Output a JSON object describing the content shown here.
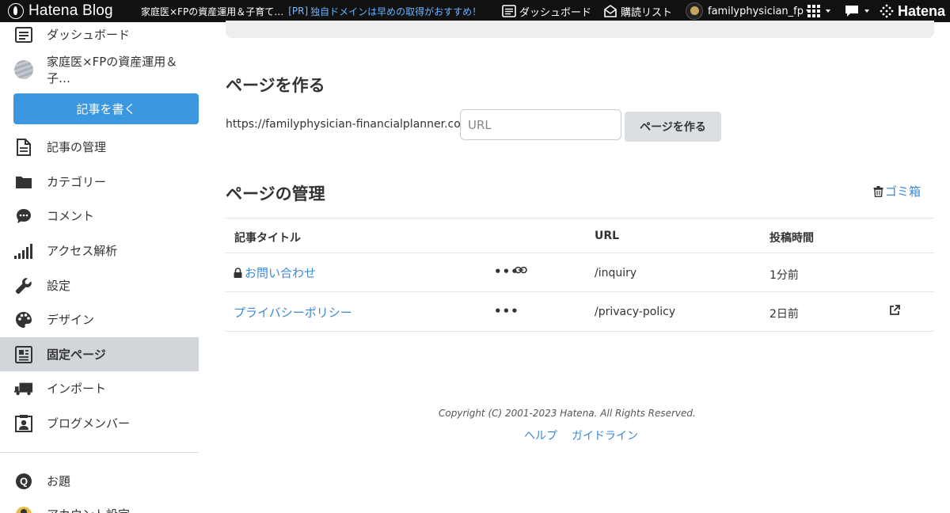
{
  "topbar": {
    "brand": "Hatena Blog",
    "blog_name": "家庭医×FPの資産運用＆子育て…",
    "promo_tag": "[PR]",
    "promo_text": "独自ドメインは早めの取得がおすすめ！",
    "dashboard_label": "ダッシュボード",
    "reading_list_label": "購読リスト",
    "user_name": "familyphysician_fp",
    "hatena_label": "Hatena"
  },
  "sidebar": {
    "dashboard": "ダッシュボード",
    "blog_name": "家庭医×FPの資産運用＆子…",
    "write_button": "記事を書く",
    "items": [
      {
        "label": "記事の管理",
        "icon": "document-icon"
      },
      {
        "label": "カテゴリー",
        "icon": "folder-icon"
      },
      {
        "label": "コメント",
        "icon": "comment-icon"
      },
      {
        "label": "アクセス解析",
        "icon": "bar-chart-icon"
      },
      {
        "label": "設定",
        "icon": "wrench-icon"
      },
      {
        "label": "デザイン",
        "icon": "palette-icon"
      },
      {
        "label": "固定ページ",
        "icon": "pages-icon",
        "active": true
      },
      {
        "label": "インポート",
        "icon": "truck-icon"
      },
      {
        "label": "ブログメンバー",
        "icon": "member-icon"
      }
    ],
    "odai": "お題",
    "account": "アカウント設定"
  },
  "create": {
    "heading": "ページを作る",
    "url_prefix": "https://familyphysician-financialplanner.com/",
    "url_placeholder": "URL",
    "button": "ページを作る"
  },
  "manage": {
    "heading": "ページの管理",
    "trash": "ゴミ箱",
    "columns": [
      "記事タイトル",
      "URL",
      "投稿時間"
    ],
    "rows": [
      {
        "title": "お問い合わせ",
        "locked": true,
        "more": "•••",
        "url": "/inquiry",
        "time": "1分前"
      },
      {
        "title": "プライバシーポリシー",
        "locked": false,
        "more": "•••",
        "url": "/privacy-policy",
        "time": "2日前"
      }
    ]
  },
  "footer": {
    "copyright": "Copyright (C) 2001-2023 Hatena. All Rights Reserved.",
    "help": "ヘルプ",
    "guidelines": "ガイドライン"
  },
  "colors": {
    "accent": "#3a97e0",
    "link": "#3a8ad8",
    "topbar": "#111111",
    "active_item": "#d2d6db"
  }
}
